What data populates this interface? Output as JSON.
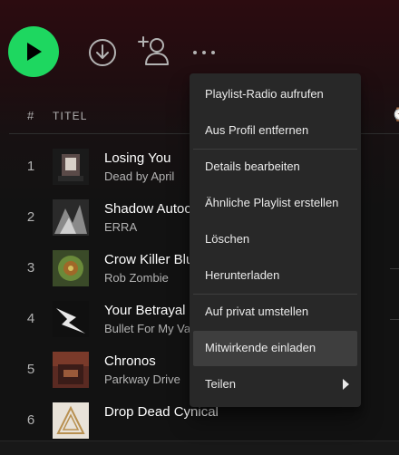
{
  "header": {
    "index_label": "#",
    "title_label": "TITEL"
  },
  "icons": {
    "play": "play-icon",
    "download": "download-circle-icon",
    "follow": "add-user-icon",
    "more": "more-horizontal-icon",
    "submenu": "chevron-right-icon"
  },
  "colors": {
    "accent": "#1ed760",
    "menu_bg": "#282828",
    "menu_hover": "#3e3e3e"
  },
  "tracks": [
    {
      "number": "1",
      "title": "Losing You",
      "artist": "Dead by April"
    },
    {
      "number": "2",
      "title": "Shadow Autocracy",
      "artist": "ERRA"
    },
    {
      "number": "3",
      "title": "Crow Killer Blues",
      "artist": "Rob Zombie"
    },
    {
      "number": "4",
      "title": "Your Betrayal",
      "artist": "Bullet For My Valentine"
    },
    {
      "number": "5",
      "title": "Chronos",
      "artist": "Parkway Drive"
    },
    {
      "number": "6",
      "title": "Drop Dead Cynical",
      "artist": ""
    }
  ],
  "context_menu": {
    "items": [
      {
        "label": "Playlist-Radio aufrufen"
      },
      {
        "label": "Aus Profil entfernen"
      },
      {
        "label": "Details bearbeiten"
      },
      {
        "label": "Ähnliche Playlist erstellen"
      },
      {
        "label": "Löschen"
      },
      {
        "label": "Herunterladen"
      },
      {
        "label": "Auf privat umstellen"
      },
      {
        "label": "Mitwirkende einladen"
      },
      {
        "label": "Teilen"
      }
    ]
  }
}
